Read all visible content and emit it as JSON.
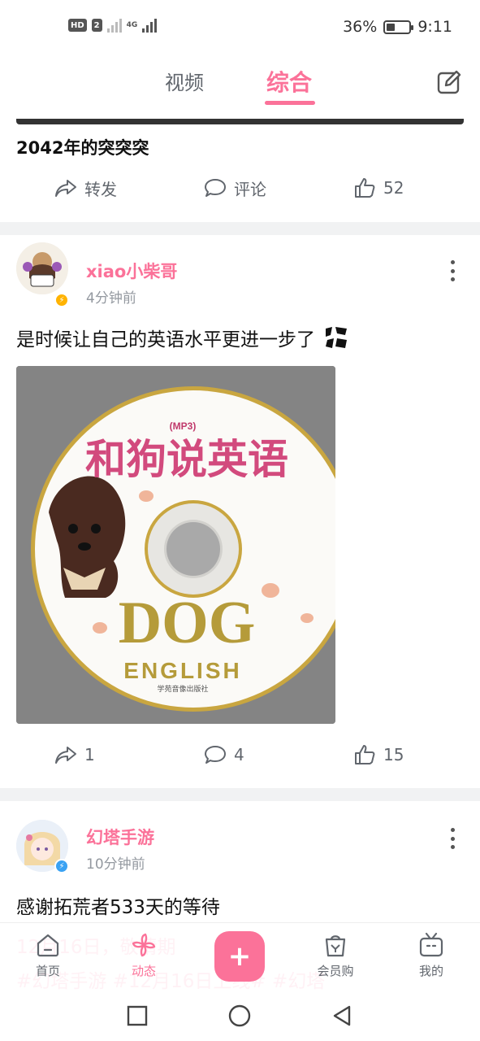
{
  "status_bar": {
    "network": "HD",
    "sim": "2",
    "signal": "4G",
    "battery_pct": "36%",
    "battery_level": 0.36,
    "time": "9:11"
  },
  "tabs": [
    {
      "label": "视频"
    },
    {
      "label": "综合"
    }
  ],
  "active_tab": "综合",
  "post1": {
    "title": "2042年的突突突",
    "repost": "转发",
    "comment": "评论",
    "likes": "52"
  },
  "post2": {
    "username": "xiao小柴哥",
    "time": "4分钟前",
    "text": "是时候让自己的英语水平更进一步了",
    "image": {
      "cd_title": "和狗说英语",
      "cd_tag": "(MP3)",
      "dog": "DOG",
      "english": "ENGLISH",
      "publisher": "学苑音像出版社"
    },
    "reposts": "1",
    "comments": "4",
    "likes": "15"
  },
  "post3": {
    "username": "幻塔手游",
    "time": "10分钟前",
    "text": "感谢拓荒者533天的等待",
    "overlay_line1": "12月16日，敬请期",
    "overlay_line2": "#幻塔手游 #12月16日上线# #幻塔"
  },
  "bottom_nav": [
    {
      "label": "首页",
      "icon": "home-icon"
    },
    {
      "label": "动态",
      "icon": "pinwheel-icon"
    },
    {
      "label": "+",
      "icon": "plus-icon"
    },
    {
      "label": "会员购",
      "icon": "shopping-bag-icon"
    },
    {
      "label": "我的",
      "icon": "tv-icon"
    }
  ],
  "colors": {
    "accent": "#fb7299",
    "text": "#18191c",
    "muted": "#61666d",
    "gray": "#9499a0"
  }
}
